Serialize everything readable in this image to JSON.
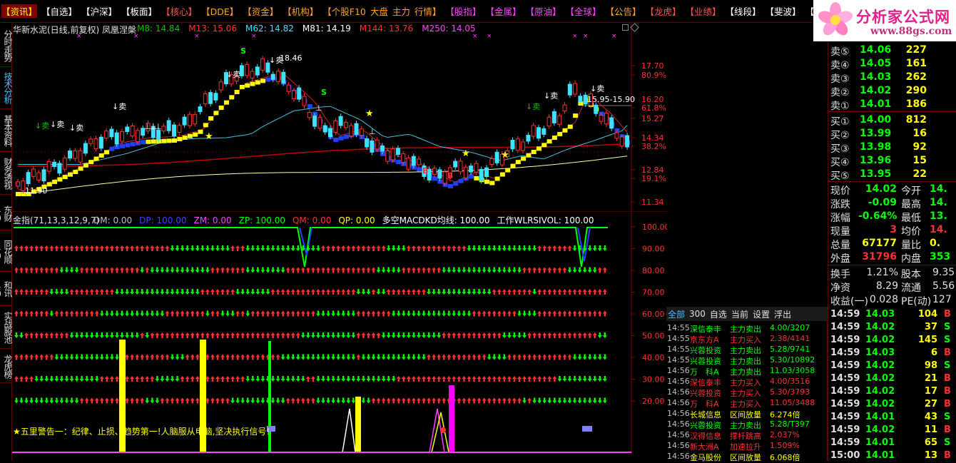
{
  "menu": [
    {
      "label": "【资讯】",
      "color": "#ff3030",
      "active": true
    },
    {
      "label": "【自选】",
      "color": "#ffffff"
    },
    {
      "label": "【沪深】",
      "color": "#ffffff"
    },
    {
      "label": "【板面】",
      "color": "#ffffff"
    },
    {
      "label": "【核心】",
      "color": "#ff5050"
    },
    {
      "label": "【DDE】",
      "color": "#ffa020"
    },
    {
      "label": "【资金】",
      "color": "#ffa020"
    },
    {
      "label": "【机构】",
      "color": "#ffa020"
    },
    {
      "label": "【个股F10",
      "color": "#ffa020"
    },
    {
      "label": "大盘",
      "color": "#ffa020"
    },
    {
      "label": "主力",
      "color": "#ffa020"
    },
    {
      "label": "行情】",
      "color": "#ffa020"
    },
    {
      "label": "【股指】",
      "color": "#ff40ff"
    },
    {
      "label": "【金属】",
      "color": "#ff40ff"
    },
    {
      "label": "【原油】",
      "color": "#ff40ff"
    },
    {
      "label": "【全球】",
      "color": "#ff40ff"
    },
    {
      "label": "【公告】",
      "color": "#ffa020"
    },
    {
      "label": "【龙虎】",
      "color": "#ff5050"
    },
    {
      "label": "【业绩】",
      "color": "#ff5050"
    },
    {
      "label": "【线段】",
      "color": "#ffffff"
    },
    {
      "label": "【斐波】",
      "color": "#ffffff"
    },
    {
      "label": "【文字】",
      "color": "#ffffff"
    },
    {
      "label": "【标价】",
      "color": "#ffffff"
    }
  ],
  "logo": {
    "brand": "分析家公式网",
    "site": "www.88gs.com"
  },
  "left_tabs": [
    "分时走势",
    "技术分析",
    "基本资料",
    "财务透视",
    "东财10",
    "同花顺10",
    "和讯10",
    "实战股池",
    "龙虎榜"
  ],
  "chart_header": {
    "title": "华新水泥(日线,前复权) 凤凰涅槃",
    "mas": [
      {
        "label": "M8: 14.84",
        "color": "#00c000"
      },
      {
        "label": "M13: 15.06",
        "color": "#ff3030"
      },
      {
        "label": "M62: 14.82",
        "color": "#40e0ff"
      },
      {
        "label": "M81: 14.19",
        "color": "#ffffff"
      },
      {
        "label": "M144: 13.76",
        "color": "#ff3030"
      },
      {
        "label": "M250: 14.05",
        "color": "#ff40ff"
      }
    ]
  },
  "price_axis": [
    {
      "label": "17.70",
      "color": "#ff3030"
    },
    {
      "label": "80.9%",
      "color": "#ff3030"
    },
    {
      "label": "16.20",
      "color": "#ff3030"
    },
    {
      "label": "61.8%",
      "color": "#ff3030"
    },
    {
      "label": "15.27",
      "color": "#ff3030"
    },
    {
      "label": "14.34",
      "color": "#ff3030"
    },
    {
      "label": "38.2%",
      "color": "#ff3030"
    },
    {
      "label": "12.84",
      "color": "#ff3030"
    },
    {
      "label": "19.1%",
      "color": "#ff3030"
    },
    {
      "label": "11.34",
      "color": "#ff3030"
    }
  ],
  "annotations": {
    "sell": "卖",
    "high_label": "18.46",
    "range_label": "15.95-15.90",
    "low_label": "11.90",
    "s": "S",
    "b": "B"
  },
  "indicator_header": {
    "name": "金指(71,13,3,12,9,7)",
    "fields": [
      {
        "label": "DM: 0.00",
        "color": "#c0c0c0"
      },
      {
        "label": "DP: 100.00",
        "color": "#4040ff"
      },
      {
        "label": "ZM: 0.00",
        "color": "#ff40ff"
      },
      {
        "label": "ZP: 100.00",
        "color": "#00ff00"
      },
      {
        "label": "QM: 0.00",
        "color": "#ff3030"
      },
      {
        "label": "QP: 0.00",
        "color": "#ffff00"
      },
      {
        "label": "多空MACDKD均线: 100.00",
        "color": "#ffffff"
      },
      {
        "label": "工作WLRSIVOL: 100.00",
        "color": "#ffffff"
      }
    ]
  },
  "indicator_axis": [
    "100.00",
    "90.00",
    "80.00",
    "70.00",
    "60.00",
    "50.00",
    "40.00",
    "30.00",
    "20.00"
  ],
  "warning": "★五里警告一：纪律、止损、趋势第一!人脑服从电脑,坚决执行信号!",
  "quote": {
    "asks": [
      {
        "label": "卖⑤",
        "price": "14.06",
        "vol": "227"
      },
      {
        "label": "卖④",
        "price": "14.05",
        "vol": "161"
      },
      {
        "label": "卖③",
        "price": "14.03",
        "vol": "262"
      },
      {
        "label": "卖②",
        "price": "14.02",
        "vol": "290"
      },
      {
        "label": "卖①",
        "price": "14.01",
        "vol": "186"
      }
    ],
    "bids": [
      {
        "label": "买①",
        "price": "14.00",
        "vol": "812"
      },
      {
        "label": "买②",
        "price": "13.99",
        "vol": "16"
      },
      {
        "label": "买③",
        "price": "13.98",
        "vol": "92"
      },
      {
        "label": "买④",
        "price": "13.96",
        "vol": "15"
      },
      {
        "label": "买⑤",
        "price": "13.95",
        "vol": "22"
      }
    ],
    "stats": [
      {
        "l1": "现价",
        "v1": "14.02",
        "c1": "#00ff00",
        "l2": "今开",
        "v2": "14.",
        "c2": "#00ff00"
      },
      {
        "l1": "涨跌",
        "v1": "-0.09",
        "c1": "#00ff00",
        "l2": "最高",
        "v2": "14.",
        "c2": "#00ff00"
      },
      {
        "l1": "涨幅",
        "v1": "-0.64%",
        "c1": "#00ff00",
        "l2": "最低",
        "v2": "13.",
        "c2": "#00ff00"
      },
      {
        "l1": "现量",
        "v1": "3",
        "c1": "#ff3030",
        "l2": "均价",
        "v2": "14.",
        "c2": "#ff3030"
      },
      {
        "l1": "总量",
        "v1": "67177",
        "c1": "#ffff00",
        "l2": "量比",
        "v2": "0.",
        "c2": "#ffff00"
      },
      {
        "l1": "外盘",
        "v1": "31796",
        "c1": "#ff3030",
        "l2": "内盘",
        "v2": "353",
        "c2": "#00ff00"
      }
    ],
    "stats2": [
      {
        "l1": "换手",
        "v1": "1.21%",
        "l2": "股本",
        "v2": "9.35"
      },
      {
        "l1": "净资",
        "v1": "8.29",
        "l2": "流通",
        "v2": "5.56"
      },
      {
        "l1": "收益(一)",
        "v1": "0.028",
        "l2": "PE(动)",
        "v2": "127"
      }
    ]
  },
  "tick_tabs": [
    "全部",
    "300",
    "自选",
    "当前",
    "设置",
    "浮出"
  ],
  "ticks": [
    {
      "t": "14:55",
      "n": "深信泰丰",
      "a": "主力卖出",
      "v": "4.00/3207",
      "c": "#00ff00"
    },
    {
      "t": "14:55",
      "n": "京东方A",
      "a": "主力买入",
      "v": "2.38/4141",
      "c": "#ff3030"
    },
    {
      "t": "14:55",
      "n": "兴蓉投资",
      "a": "主力卖出",
      "v": "5.28/9741",
      "c": "#00ff00"
    },
    {
      "t": "14:55",
      "n": "兴蓉投资",
      "a": "主力卖出",
      "v": "5.30/10892",
      "c": "#00ff00"
    },
    {
      "t": "14:56",
      "n": "万　科A",
      "a": "主力卖出",
      "v": "11.03/3058",
      "c": "#00ff00"
    },
    {
      "t": "14:56",
      "n": "深信泰丰",
      "a": "主力买入",
      "v": "4.00/3516",
      "c": "#ff3030"
    },
    {
      "t": "14:56",
      "n": "兴蓉投资",
      "a": "主力买入",
      "v": "5.30/3793",
      "c": "#ff3030"
    },
    {
      "t": "14:56",
      "n": "万　科A",
      "a": "主力买入",
      "v": "11.05/3488",
      "c": "#ff3030"
    },
    {
      "t": "14:56",
      "n": "长城信息",
      "a": "区间放量",
      "v": "6.274倍",
      "c": "#ffff00"
    },
    {
      "t": "14:56",
      "n": "兴蓉投资",
      "a": "主力卖出",
      "v": "5.28/T397",
      "c": "#00ff00"
    },
    {
      "t": "14:56",
      "n": "汉得信息",
      "a": "撑杆跳高",
      "v": "2.037%",
      "c": "#ff3030"
    },
    {
      "t": "14:56",
      "n": "新大洲A",
      "a": "加速拉升",
      "v": "1.509%",
      "c": "#ff3030"
    },
    {
      "t": "14:56",
      "n": "金马股份",
      "a": "区间放量",
      "v": "6.068倍",
      "c": "#ffff00"
    }
  ],
  "trades": [
    {
      "t": "14:59",
      "p": "14.03",
      "v": "104",
      "s": "B"
    },
    {
      "t": "14:59",
      "p": "14.02",
      "v": "37",
      "s": "S"
    },
    {
      "t": "14:59",
      "p": "14.02",
      "v": "145",
      "s": "S"
    },
    {
      "t": "14:59",
      "p": "14.03",
      "v": "6",
      "s": "B"
    },
    {
      "t": "14:59",
      "p": "14.02",
      "v": "98",
      "s": "S"
    },
    {
      "t": "14:59",
      "p": "14.02",
      "v": "21",
      "s": "B"
    },
    {
      "t": "14:59",
      "p": "14.02",
      "v": "17",
      "s": "B"
    },
    {
      "t": "14:59",
      "p": "14.02",
      "v": "27",
      "s": "B"
    },
    {
      "t": "14:59",
      "p": "14.01",
      "v": "43",
      "s": "S"
    },
    {
      "t": "14:59",
      "p": "14.02",
      "v": "11",
      "s": "B"
    },
    {
      "t": "14:59",
      "p": "14.01",
      "v": "65",
      "s": "S"
    },
    {
      "t": "15:00",
      "p": "14.01",
      "v": "13",
      "s": "B"
    }
  ]
}
